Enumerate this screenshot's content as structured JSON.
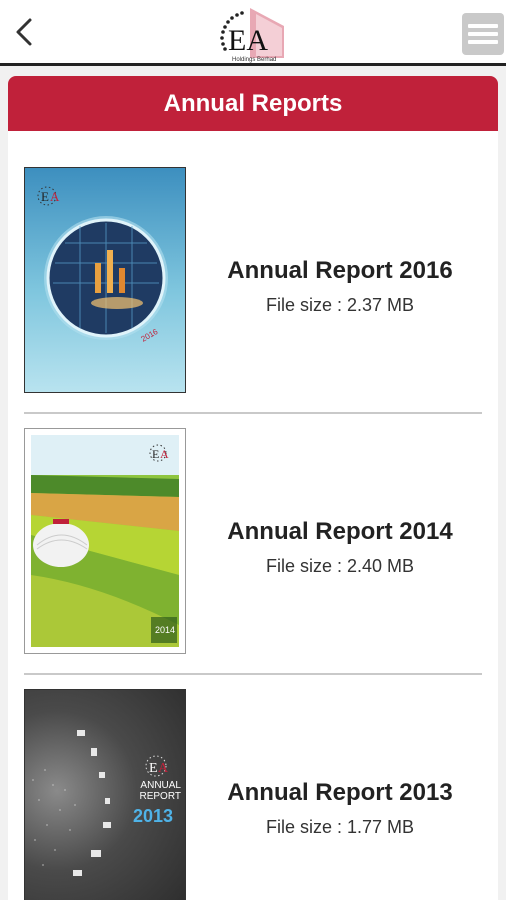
{
  "header": {
    "back_icon": "chevron-left-icon",
    "logo_letters": "EA",
    "logo_tagline": "Holdings Berhad",
    "menu_icon": "hamburger-menu-icon"
  },
  "page_title": "Annual Reports",
  "reports": [
    {
      "title": "Annual Report 2016",
      "file_size": "File size : 2.37 MB",
      "cover_year": "2016"
    },
    {
      "title": "Annual Report 2014",
      "file_size": "File size : 2.40 MB",
      "cover_year": "2014"
    },
    {
      "title": "Annual Report 2013",
      "file_size": "File size : 1.77 MB",
      "cover_heading": "ANNUAL REPORT",
      "cover_year": "2013"
    }
  ],
  "colors": {
    "accent": "#c0213a",
    "divider": "#c9c9c9",
    "menu_button": "#c9c9c9"
  }
}
